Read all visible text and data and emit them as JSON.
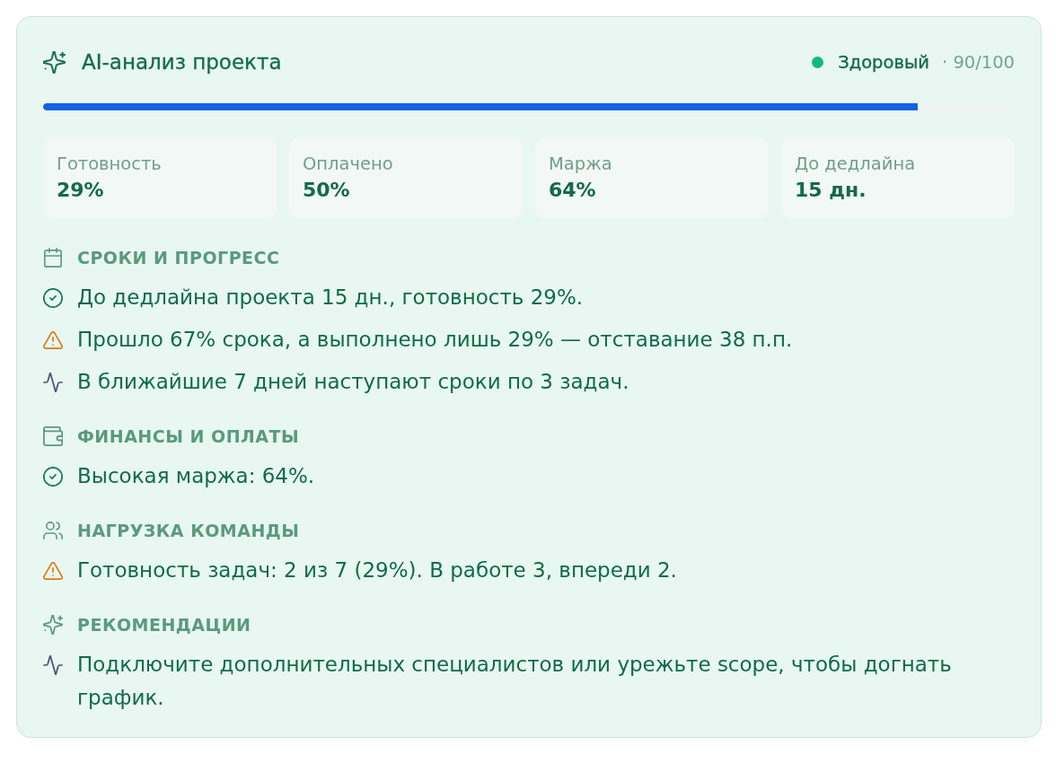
{
  "header": {
    "title": "AI-анализ проекта",
    "status": {
      "label": "Здоровый",
      "color": "#10b981"
    },
    "score": "· 90/100"
  },
  "progress": {
    "level": 0.9
  },
  "metrics": [
    {
      "label": "Готовность",
      "value": "29%"
    },
    {
      "label": "Оплачено",
      "value": "50%"
    },
    {
      "label": "Маржа",
      "value": "64%"
    },
    {
      "label": "До дедлайна",
      "value": "15 дн."
    }
  ],
  "sections": [
    {
      "kind": "schedule",
      "title": "СРОКИ И ПРОГРЕСС",
      "items": [
        {
          "kind": "ok",
          "text": "До дедлайна проекта 15 дн., готовность 29%."
        },
        {
          "kind": "warning",
          "text": "Прошло 67% срока, а выполнено лишь 29% — отставание 38 п.п."
        },
        {
          "kind": "trend",
          "text": "В ближайшие 7 дней наступают сроки по 3 задач."
        }
      ]
    },
    {
      "kind": "finance",
      "title": "ФИНАНСЫ И ОПЛАТЫ",
      "items": [
        {
          "kind": "ok",
          "text": "Высокая маржа: 64%."
        }
      ]
    },
    {
      "kind": "team",
      "title": "НАГРУЗКА КОМАНДЫ",
      "items": [
        {
          "kind": "warning",
          "text": "Готовность задач: 2 из 7 (29%). В работе 3, впереди 2."
        }
      ]
    },
    {
      "kind": "advice",
      "title": "РЕКОМЕНДАЦИИ",
      "items": [
        {
          "kind": "trend",
          "text": "Подключите дополнительных специалистов или урежьте scope, чтобы догнать график."
        }
      ]
    }
  ]
}
